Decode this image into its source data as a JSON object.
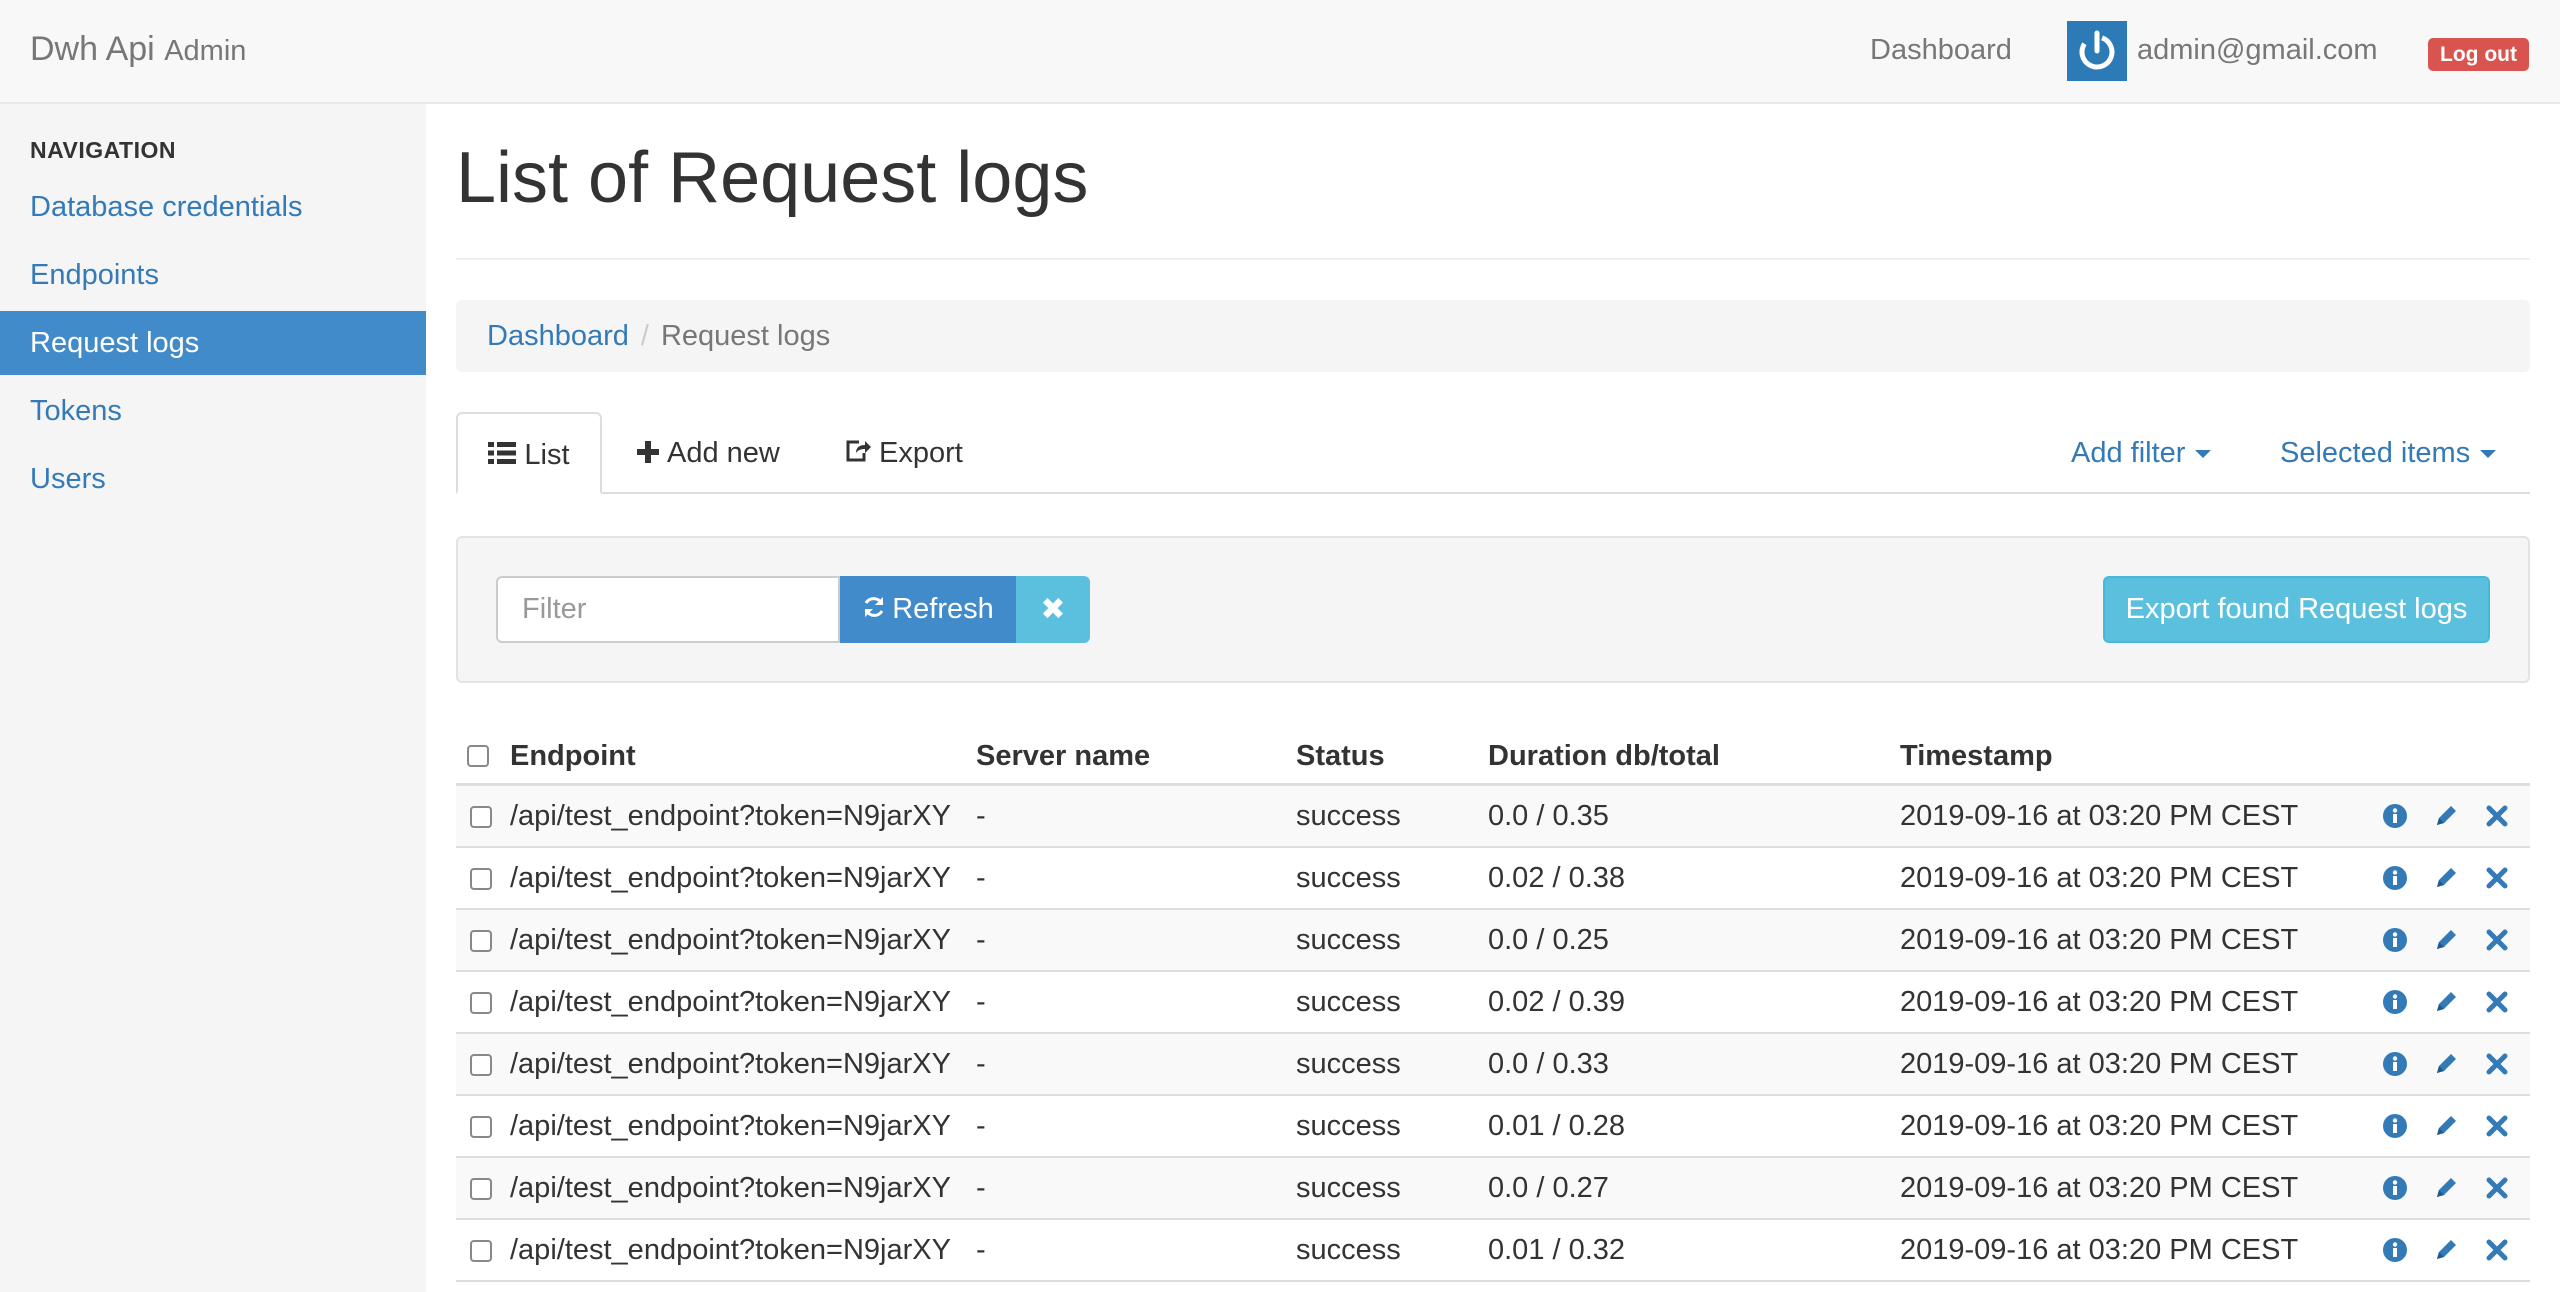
{
  "app": {
    "brand_name": "Dwh Api",
    "brand_suffix": "Admin"
  },
  "navbar": {
    "dashboard_label": "Dashboard",
    "user_email": "admin@gmail.com",
    "logout_label": "Log out",
    "avatar_icon": "power-icon"
  },
  "sidebar": {
    "header": "NAVIGATION",
    "items": [
      {
        "label": "Database credentials",
        "active": false
      },
      {
        "label": "Endpoints",
        "active": false
      },
      {
        "label": "Request logs",
        "active": true
      },
      {
        "label": "Tokens",
        "active": false
      },
      {
        "label": "Users",
        "active": false
      }
    ]
  },
  "main": {
    "title": "List of Request logs",
    "breadcrumb": {
      "link": "Dashboard",
      "separator": "/",
      "current": "Request logs"
    },
    "tabs": {
      "list": "List",
      "add_new": "Add new",
      "export": "Export",
      "add_filter": "Add filter",
      "selected_items": "Selected items"
    },
    "filter": {
      "placeholder": "Filter",
      "refresh_label": "Refresh",
      "clear_label": "✖",
      "export_found_label": "Export found Request logs"
    },
    "table": {
      "columns": [
        "Endpoint",
        "Server name",
        "Status",
        "Duration db/total",
        "Timestamp"
      ],
      "rows": [
        {
          "endpoint": "/api/test_endpoint?token=N9jarXY",
          "server": "-",
          "status": "success",
          "duration": "0.0 / 0.35",
          "timestamp": "2019-09-16 at 03:20 PM CEST"
        },
        {
          "endpoint": "/api/test_endpoint?token=N9jarXY",
          "server": "-",
          "status": "success",
          "duration": "0.02 / 0.38",
          "timestamp": "2019-09-16 at 03:20 PM CEST"
        },
        {
          "endpoint": "/api/test_endpoint?token=N9jarXY",
          "server": "-",
          "status": "success",
          "duration": "0.0 / 0.25",
          "timestamp": "2019-09-16 at 03:20 PM CEST"
        },
        {
          "endpoint": "/api/test_endpoint?token=N9jarXY",
          "server": "-",
          "status": "success",
          "duration": "0.02 / 0.39",
          "timestamp": "2019-09-16 at 03:20 PM CEST"
        },
        {
          "endpoint": "/api/test_endpoint?token=N9jarXY",
          "server": "-",
          "status": "success",
          "duration": "0.0 / 0.33",
          "timestamp": "2019-09-16 at 03:20 PM CEST"
        },
        {
          "endpoint": "/api/test_endpoint?token=N9jarXY",
          "server": "-",
          "status": "success",
          "duration": "0.01 / 0.28",
          "timestamp": "2019-09-16 at 03:20 PM CEST"
        },
        {
          "endpoint": "/api/test_endpoint?token=N9jarXY",
          "server": "-",
          "status": "success",
          "duration": "0.0 / 0.27",
          "timestamp": "2019-09-16 at 03:20 PM CEST"
        },
        {
          "endpoint": "/api/test_endpoint?token=N9jarXY",
          "server": "-",
          "status": "success",
          "duration": "0.01 / 0.32",
          "timestamp": "2019-09-16 at 03:20 PM CEST"
        }
      ],
      "row_actions": [
        "info-icon",
        "pencil-icon",
        "close-icon"
      ]
    }
  },
  "colors": {
    "link": "#337ab7",
    "primary": "#428bca",
    "info": "#5bc0de",
    "danger": "#d9534f",
    "navbar_bg": "#f8f8f8",
    "sidebar_bg": "#f5f5f5"
  }
}
